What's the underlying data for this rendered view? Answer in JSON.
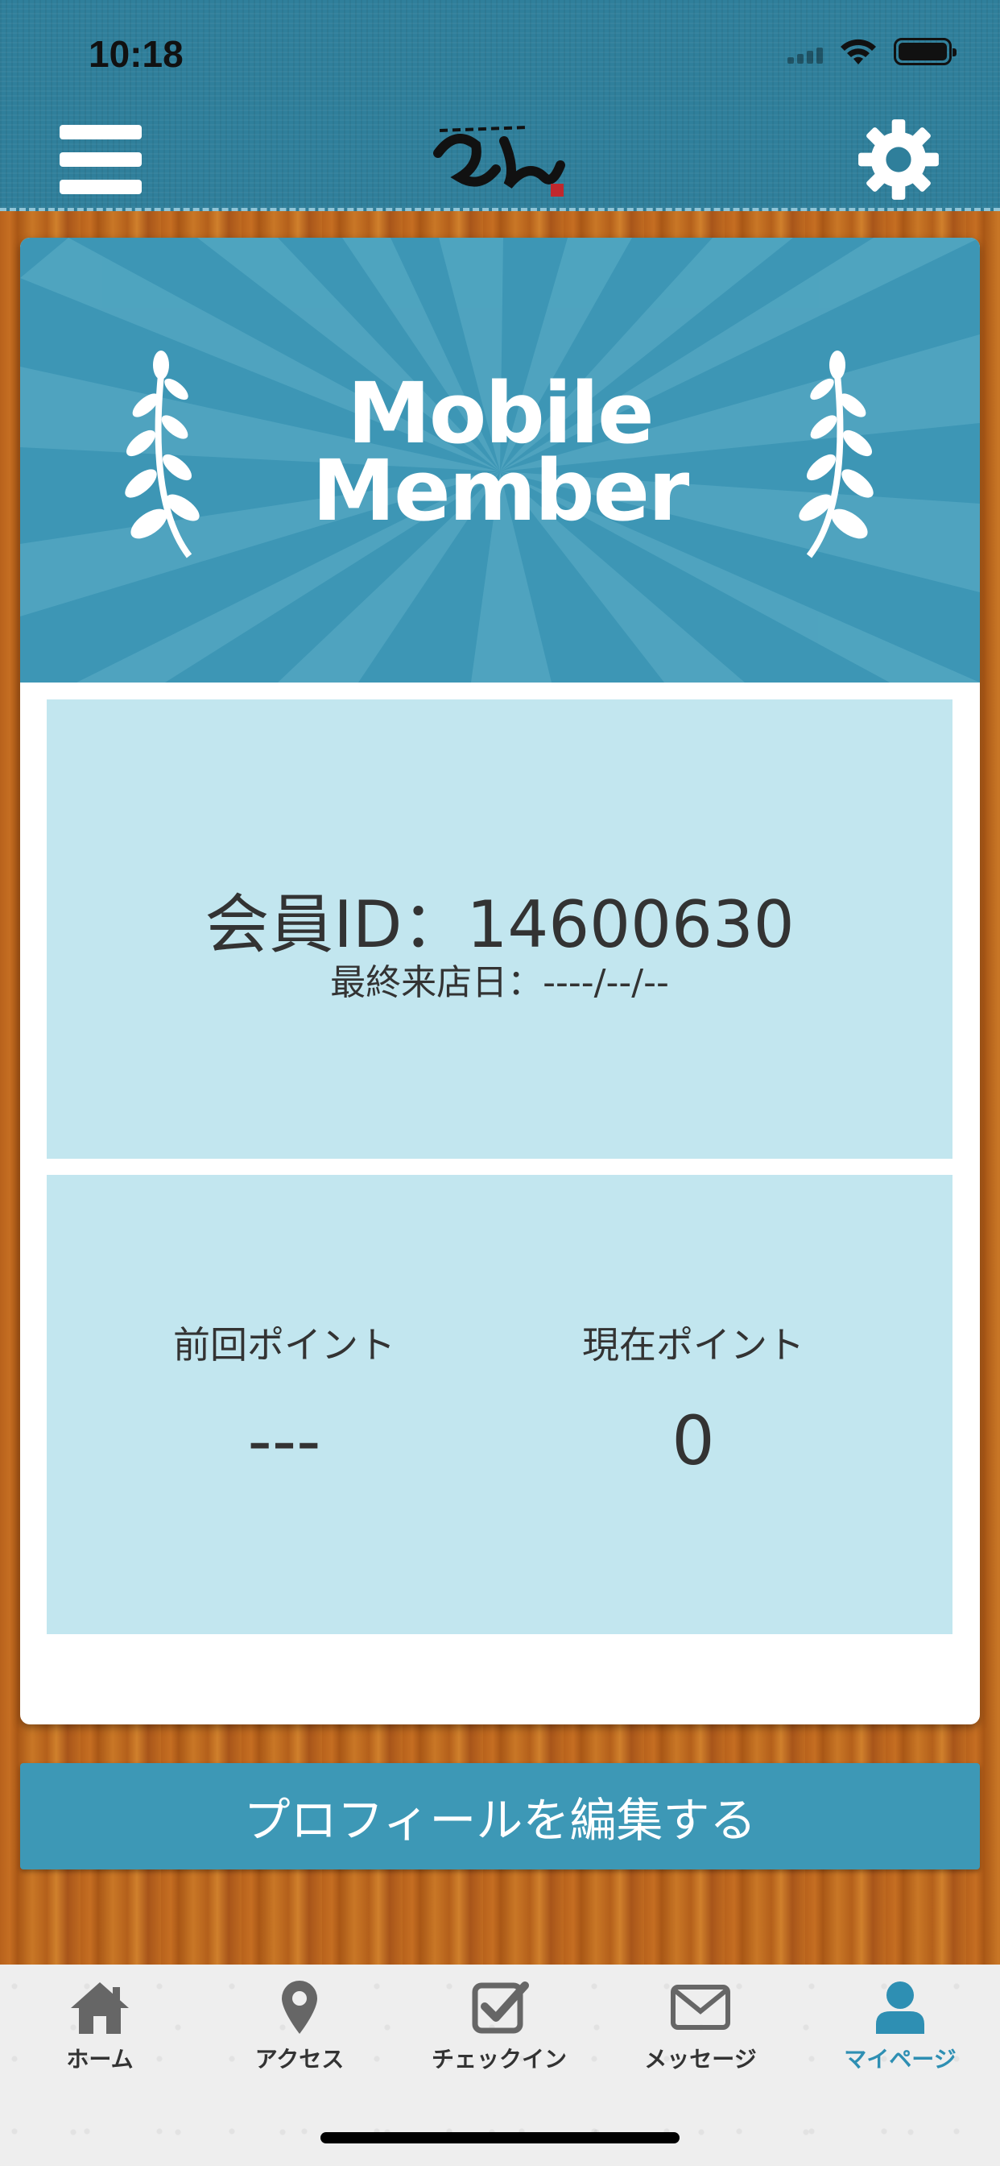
{
  "status_bar": {
    "time": "10:18"
  },
  "header": {
    "menu_icon": "hamburger-menu-icon",
    "logo": "sen-logo",
    "settings_icon": "gear-icon"
  },
  "banner": {
    "title_line1": "Mobile",
    "title_line2": "Member"
  },
  "member": {
    "id_text": "会員ID：14600630",
    "last_visit_text": "最終来店日：----/--/--"
  },
  "points": {
    "previous_label": "前回ポイント",
    "previous_value": "---",
    "current_label": "現在ポイント",
    "current_value": "0"
  },
  "actions": {
    "edit_profile_label": "プロフィールを編集する"
  },
  "tabbar": {
    "items": [
      {
        "label": "ホーム",
        "icon": "home-icon"
      },
      {
        "label": "アクセス",
        "icon": "map-pin-icon"
      },
      {
        "label": "チェックイン",
        "icon": "checkbox-icon"
      },
      {
        "label": "メッセージ",
        "icon": "envelope-icon"
      },
      {
        "label": "マイページ",
        "icon": "person-icon",
        "active": true
      }
    ]
  },
  "colors": {
    "header": "#2f7f9b",
    "banner": "#3d96b5",
    "panel": "#c2e6ef",
    "button": "#3d98b6",
    "active_tab": "#2e8fb3"
  }
}
